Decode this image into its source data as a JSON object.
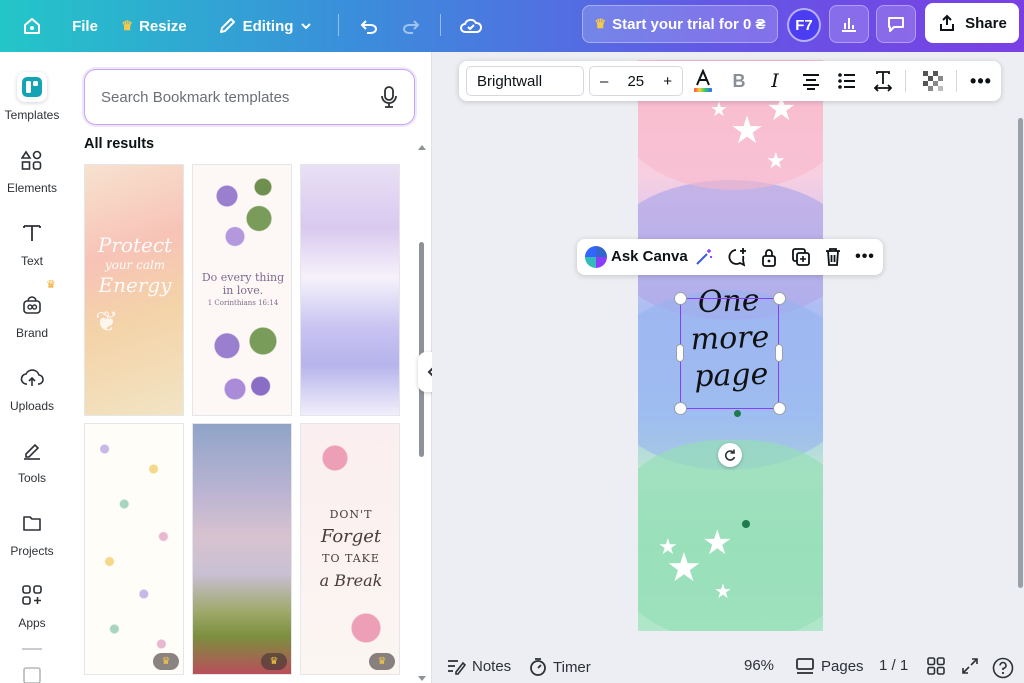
{
  "topbar": {
    "file_label": "File",
    "resize_label": "Resize",
    "editing_label": "Editing",
    "trial_label": "Start your trial for 0 ₴",
    "avatar_initials": "F7",
    "share_label": "Share"
  },
  "rail": {
    "items": [
      {
        "label": "Templates",
        "icon": "templates-icon"
      },
      {
        "label": "Elements",
        "icon": "elements-icon"
      },
      {
        "label": "Text",
        "icon": "text-icon"
      },
      {
        "label": "Brand",
        "icon": "brand-icon"
      },
      {
        "label": "Uploads",
        "icon": "uploads-icon"
      },
      {
        "label": "Tools",
        "icon": "tools-icon"
      },
      {
        "label": "Projects",
        "icon": "projects-icon"
      },
      {
        "label": "Apps",
        "icon": "apps-icon"
      }
    ]
  },
  "panel": {
    "search_placeholder": "Search Bookmark templates",
    "results_title": "All results",
    "templates": [
      {
        "name": "Protect your calm Energy",
        "lines": [
          "Protect",
          "your calm",
          "Energy"
        ]
      },
      {
        "name": "Do everything in love",
        "lines": [
          "Do every thing",
          "in love.",
          "1 Corinthians 16:14"
        ]
      },
      {
        "name": "Watercolor lavender"
      },
      {
        "name": "Wildflower pattern"
      },
      {
        "name": "Sunflower field"
      },
      {
        "name": "Don't forget to take a break",
        "lines": [
          "DON'T",
          "Forget",
          "TO TAKE",
          "a Break"
        ]
      }
    ]
  },
  "text_toolbar": {
    "font_name": "Brightwall",
    "font_size": "25",
    "minus": "–",
    "plus": "+"
  },
  "context_bar": {
    "ask_label": "Ask Canva"
  },
  "canvas": {
    "text_lines": [
      "One",
      "more",
      "page"
    ]
  },
  "bottombar": {
    "notes_label": "Notes",
    "timer_label": "Timer",
    "zoom": "96%",
    "pages_label": "Pages",
    "page_count": "1 / 1"
  },
  "colors": {
    "accent": "#8b3dff",
    "gradient_start": "#23c6c8",
    "gradient_end": "#7a3fe4"
  }
}
